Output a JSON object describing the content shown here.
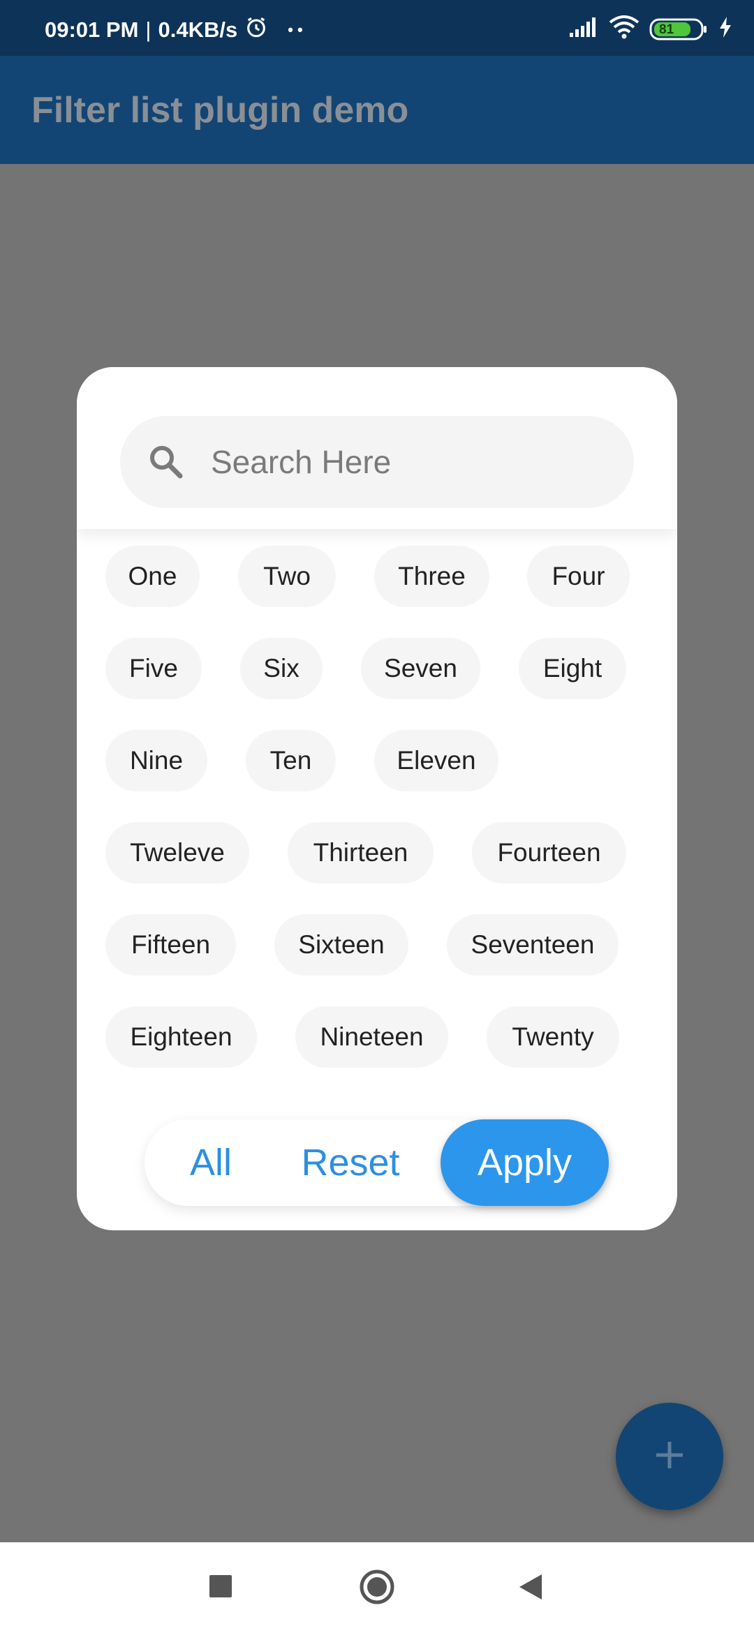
{
  "status_bar": {
    "time": "09:01 PM",
    "separator": "|",
    "speed": "0.4KB/s",
    "dots": "• •",
    "battery": "81"
  },
  "app_bar": {
    "title": "Filter list plugin demo"
  },
  "dialog": {
    "search": {
      "placeholder": "Search Here"
    },
    "chips": [
      "One",
      "Two",
      "Three",
      "Four",
      "Five",
      "Six",
      "Seven",
      "Eight",
      "Nine",
      "Ten",
      "Eleven",
      "Tweleve",
      "Thirteen",
      "Fourteen",
      "Fifteen",
      "Sixteen",
      "Seventeen",
      "Eighteen",
      "Nineteen",
      "Twenty"
    ],
    "actions": {
      "all": "All",
      "reset": "Reset",
      "apply": "Apply"
    }
  },
  "fab": {
    "icon": "plus-icon"
  },
  "colors": {
    "primary": "#124573",
    "accent": "#2c96ec",
    "scrim": "#747474"
  }
}
